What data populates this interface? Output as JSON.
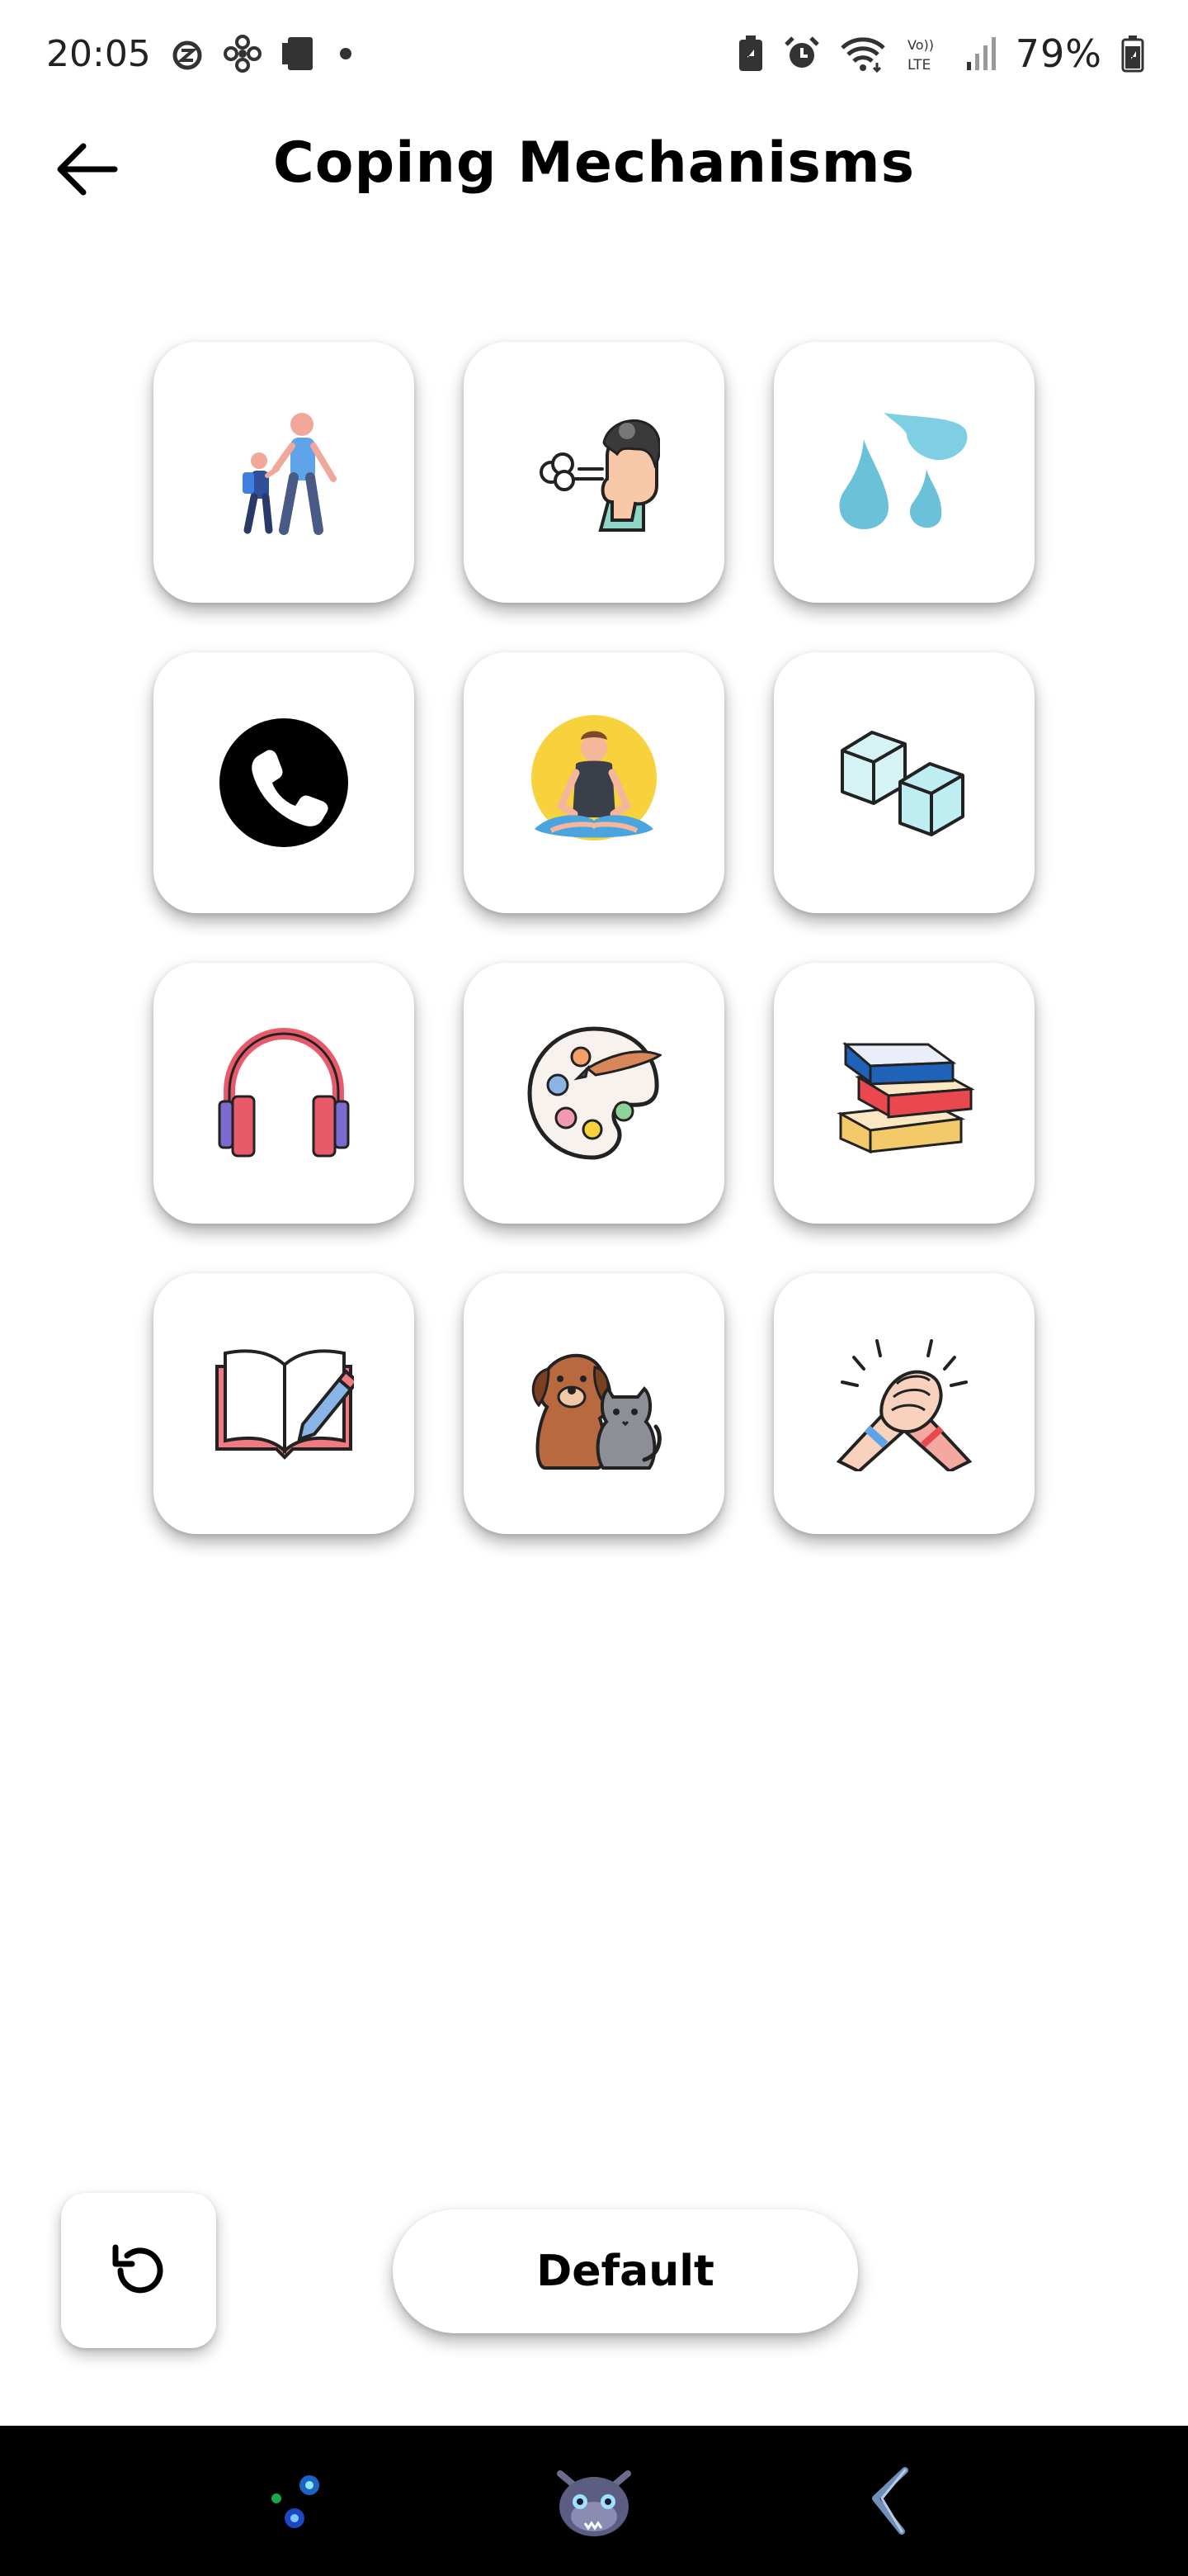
{
  "status_bar": {
    "time": "20:05",
    "battery": "79%",
    "left_icons": [
      "alarm-off-icon",
      "fan-icon",
      "device-icon",
      "dot-icon"
    ],
    "right_icons": [
      "battery-saver-icon",
      "alarm-icon",
      "wifi-icon",
      "volte-icon",
      "signal-icon",
      "battery-icon"
    ]
  },
  "header": {
    "title": "Coping Mechanisms",
    "back_icon": "arrow-left-icon"
  },
  "tiles": [
    {
      "name": "walking-icon"
    },
    {
      "name": "breathing-icon"
    },
    {
      "name": "water-drops-icon"
    },
    {
      "name": "phone-call-icon"
    },
    {
      "name": "meditation-icon"
    },
    {
      "name": "ice-cubes-icon"
    },
    {
      "name": "headphones-icon"
    },
    {
      "name": "paint-palette-icon"
    },
    {
      "name": "books-icon"
    },
    {
      "name": "journal-icon"
    },
    {
      "name": "pets-icon"
    },
    {
      "name": "friendship-handshake-icon"
    }
  ],
  "controls": {
    "reset_icon": "reset-icon",
    "default_label": "Default"
  },
  "nav_bar": {
    "items": [
      "app-drawer-icon",
      "home-mascot-icon",
      "back-gesture-icon"
    ]
  },
  "colors": {
    "background": "#ffffff",
    "nav_background": "#000000"
  }
}
